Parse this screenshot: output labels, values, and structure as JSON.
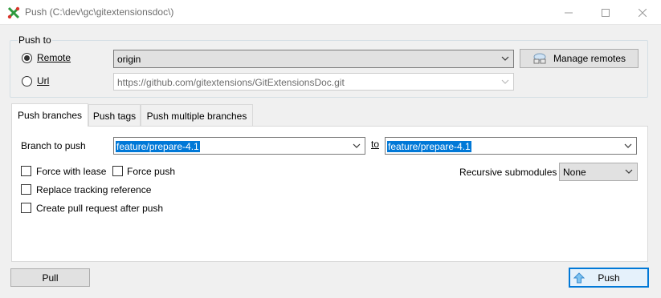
{
  "window": {
    "title": "Push (C:\\dev\\gc\\gitextensionsdoc\\)",
    "icons": {
      "app": "git-extensions-icon",
      "minimize": "minimize-icon",
      "maximize": "maximize-icon",
      "close": "close-icon"
    }
  },
  "push_to": {
    "group_label": "Push to",
    "remote_label": "Remote",
    "remote_value": "origin",
    "url_label": "Url",
    "url_value": "https://github.com/gitextensions/GitExtensionsDoc.git",
    "manage_remotes_label": "Manage remotes",
    "selected": "Remote"
  },
  "tabs": [
    {
      "label": "Push branches",
      "active": true
    },
    {
      "label": "Push tags",
      "active": false
    },
    {
      "label": "Push multiple branches",
      "active": false
    }
  ],
  "branches": {
    "branch_to_push_label": "Branch to push",
    "local_branch": "feature/prepare-4.1",
    "to_label": "to",
    "remote_branch": "feature/prepare-4.1",
    "force_with_lease_label": "Force with lease",
    "force_push_label": "Force push",
    "replace_tracking_label": "Replace tracking reference",
    "create_pr_label": "Create pull request after push",
    "recursive_submodules_label": "Recursive submodules",
    "recursive_submodules_value": "None"
  },
  "footer": {
    "pull_label": "Pull",
    "push_label": "Push"
  },
  "colors": {
    "accent": "#0078d7",
    "selection": "#0078d7"
  }
}
